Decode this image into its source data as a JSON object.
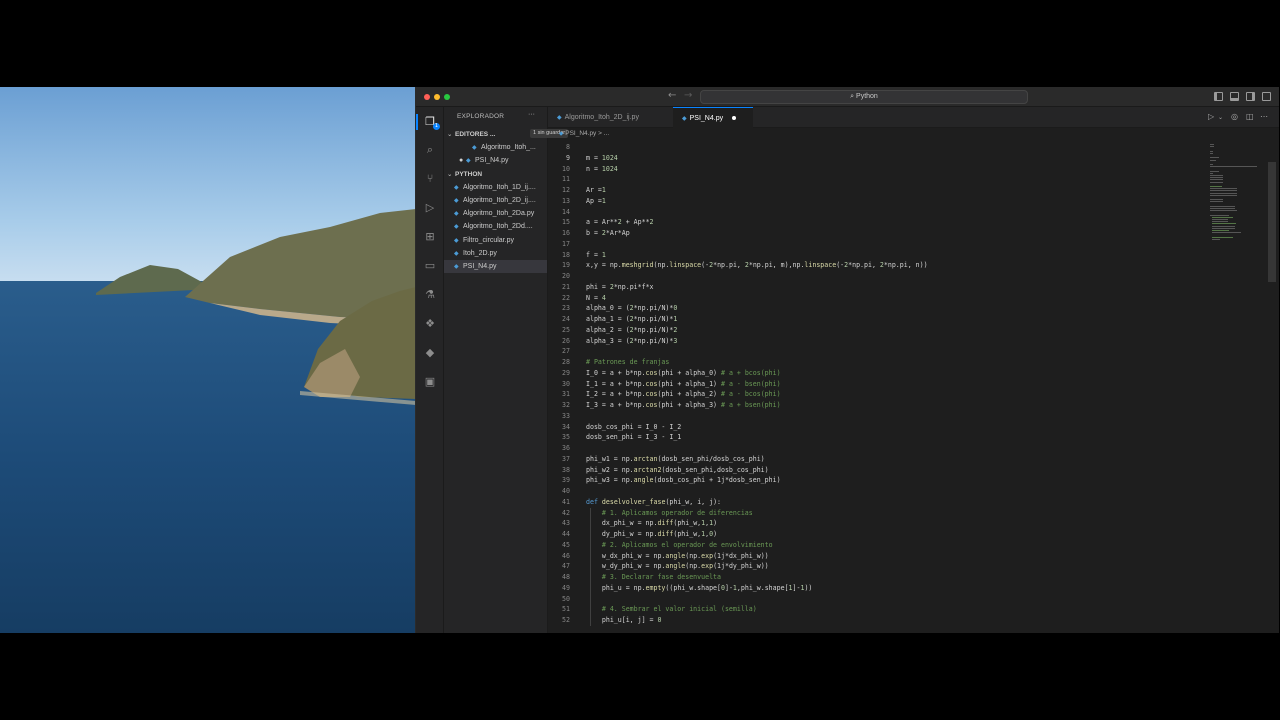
{
  "window": {
    "search_label": "Python"
  },
  "activity_bar": {
    "items": [
      "files-icon",
      "search-icon",
      "source-control-icon",
      "run-debug-icon",
      "extensions-icon",
      "remote-explorer-icon",
      "testing-icon",
      "docker-icon",
      "python-icon",
      "terminal-icon"
    ],
    "badge": "1"
  },
  "sidebar": {
    "title": "EXPLORADOR",
    "more": "···",
    "open_editors": {
      "label": "EDITORES ...",
      "badge": "1 sin guardar",
      "files": [
        "Algoritmo_Itoh_...",
        "PSI_N4.py"
      ]
    },
    "folder": {
      "label": "PYTHON",
      "files": [
        "Algoritmo_Itoh_1D_ij....",
        "Algoritmo_Itoh_2D_ij....",
        "Algoritmo_Itoh_2Da.py",
        "Algoritmo_Itoh_2Dd....",
        "Filtro_circular.py",
        "Itoh_2D.py",
        "PSI_N4.py"
      ]
    }
  },
  "tabs": [
    {
      "label": "Algoritmo_Itoh_2D_ij.py"
    },
    {
      "label": "PSI_N4.py"
    }
  ],
  "breadcrumb": "PSI_N4.py > ...",
  "editor": {
    "current_line": 9,
    "lines": [
      {
        "n": "8",
        "t": ""
      },
      {
        "n": "9",
        "t": "m = 1024"
      },
      {
        "n": "10",
        "t": "n = 1024"
      },
      {
        "n": "11",
        "t": ""
      },
      {
        "n": "12",
        "t": "Ar =1"
      },
      {
        "n": "13",
        "t": "Ap =1"
      },
      {
        "n": "14",
        "t": ""
      },
      {
        "n": "15",
        "t": "a = Ar**2 + Ap**2"
      },
      {
        "n": "16",
        "t": "b = 2*Ar*Ap"
      },
      {
        "n": "17",
        "t": ""
      },
      {
        "n": "18",
        "t": "f = 1"
      },
      {
        "n": "19",
        "t": "x,y = np.meshgrid(np.linspace(-2*np.pi, 2*np.pi, m),np.linspace(-2*np.pi, 2*np.pi, n))"
      },
      {
        "n": "20",
        "t": ""
      },
      {
        "n": "21",
        "t": "phi = 2*np.pi*f*x"
      },
      {
        "n": "22",
        "t": "N = 4"
      },
      {
        "n": "23",
        "t": "alpha_0 = (2*np.pi/N)*0"
      },
      {
        "n": "24",
        "t": "alpha_1 = (2*np.pi/N)*1"
      },
      {
        "n": "25",
        "t": "alpha_2 = (2*np.pi/N)*2"
      },
      {
        "n": "26",
        "t": "alpha_3 = (2*np.pi/N)*3"
      },
      {
        "n": "27",
        "t": ""
      },
      {
        "n": "28",
        "t": "# Patrones de franjas"
      },
      {
        "n": "29",
        "t": "I_0 = a + b*np.cos(phi + alpha_0) # a + bcos(phi)"
      },
      {
        "n": "30",
        "t": "I_1 = a + b*np.cos(phi + alpha_1) # a - bsen(phi)"
      },
      {
        "n": "31",
        "t": "I_2 = a + b*np.cos(phi + alpha_2) # a - bcos(phi)"
      },
      {
        "n": "32",
        "t": "I_3 = a + b*np.cos(phi + alpha_3) # a + bsen(phi)"
      },
      {
        "n": "33",
        "t": ""
      },
      {
        "n": "34",
        "t": "dosb_cos_phi = I_0 - I_2"
      },
      {
        "n": "35",
        "t": "dosb_sen_phi = I_3 - I_1"
      },
      {
        "n": "36",
        "t": ""
      },
      {
        "n": "37",
        "t": "phi_w1 = np.arctan(dosb_sen_phi/dosb_cos_phi)"
      },
      {
        "n": "38",
        "t": "phi_w2 = np.arctan2(dosb_sen_phi,dosb_cos_phi)"
      },
      {
        "n": "39",
        "t": "phi_w3 = np.angle(dosb_cos_phi + 1j*dosb_sen_phi)"
      },
      {
        "n": "40",
        "t": ""
      },
      {
        "n": "41",
        "t": "def deselvolver_fase(phi_w, i, j):"
      },
      {
        "n": "42",
        "t": "    # 1. Aplicamos operador de diferencias"
      },
      {
        "n": "43",
        "t": "    dx_phi_w = np.diff(phi_w,1,1)"
      },
      {
        "n": "44",
        "t": "    dy_phi_w = np.diff(phi_w,1,0)"
      },
      {
        "n": "45",
        "t": "    # 2. Aplicamos el operador de envolvimiento"
      },
      {
        "n": "46",
        "t": "    w_dx_phi_w = np.angle(np.exp(1j*dx_phi_w))"
      },
      {
        "n": "47",
        "t": "    w_dy_phi_w = np.angle(np.exp(1j*dy_phi_w))"
      },
      {
        "n": "48",
        "t": "    # 3. Declarar fase desenvuelta"
      },
      {
        "n": "49",
        "t": "    phi_u = np.empty((phi_w.shape[0]-1,phi_w.shape[1]-1))"
      },
      {
        "n": "50",
        "t": ""
      },
      {
        "n": "51",
        "t": "    # 4. Sembrar el valor inicial (semilla)"
      },
      {
        "n": "52",
        "t": "    phi_u[i, j] = 0"
      }
    ]
  }
}
